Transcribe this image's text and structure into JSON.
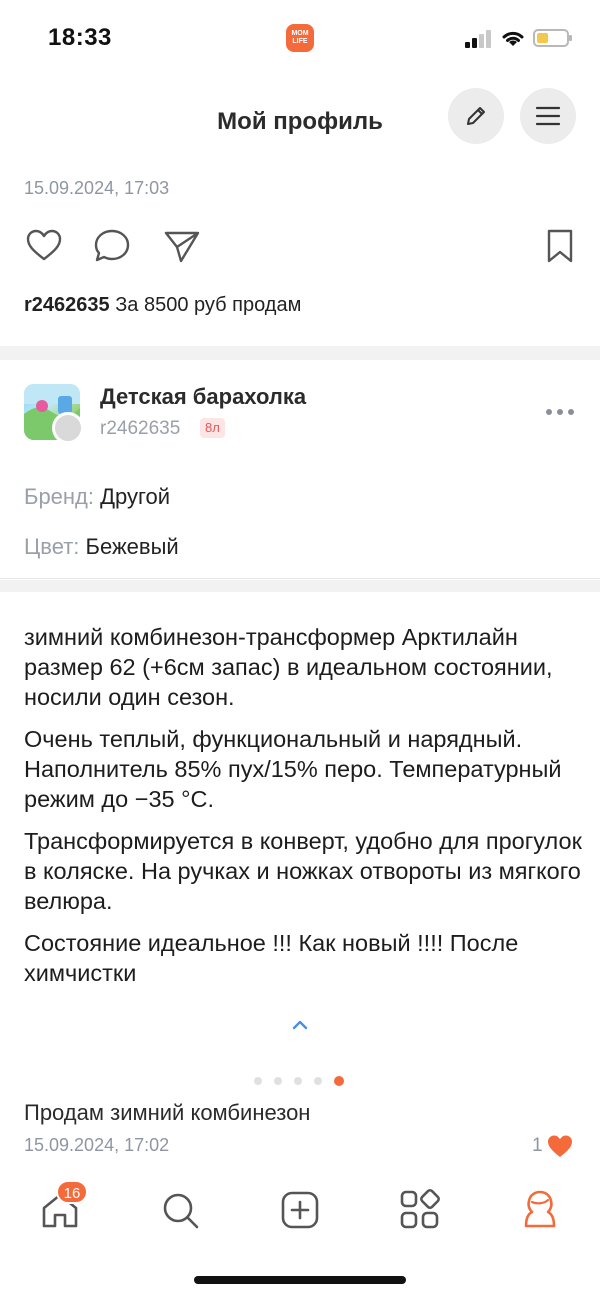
{
  "status_bar": {
    "time": "18:33",
    "app_logo_text": "MOM LIFE"
  },
  "header": {
    "title": "Мой профиль"
  },
  "previous_post": {
    "date": "15.09.2024, 17:03",
    "author": "r2462635",
    "text": " За 8500 руб продам"
  },
  "group_post": {
    "group_name": "Детская барахолка",
    "user": "r2462635",
    "user_badge": "8л",
    "properties": [
      {
        "key": "Бренд: ",
        "value": "Другой"
      },
      {
        "key": "Цвет: ",
        "value": "Бежевый"
      }
    ],
    "description": [
      "зимний комбинезон-трансформер Арктилайн размер 62 (+6см запас) в идеальном состоянии, носили один сезон.",
      "Очень теплый, функциональный и нарядный. Наполнитель 85% пух/15% перо. Температурный режим до −35 °С.",
      "Трансформируется в конверт, удобно для прогулок в коляске. На ручках и ножках отвороты из мягкого велюра.",
      "Состояние идеальное !!! Как новый !!!! После химчистки"
    ],
    "carousel": {
      "total": 5,
      "active_index": 4
    },
    "title": "Продам зимний комбинезон",
    "date": "15.09.2024, 17:02",
    "likes": "1"
  },
  "tabbar": {
    "badge": "16",
    "tabs": [
      "home-icon",
      "search-icon",
      "add-icon",
      "catalog-icon",
      "profile-icon"
    ]
  },
  "colors": {
    "accent": "#f46a3a",
    "muted": "#8f96a3"
  }
}
